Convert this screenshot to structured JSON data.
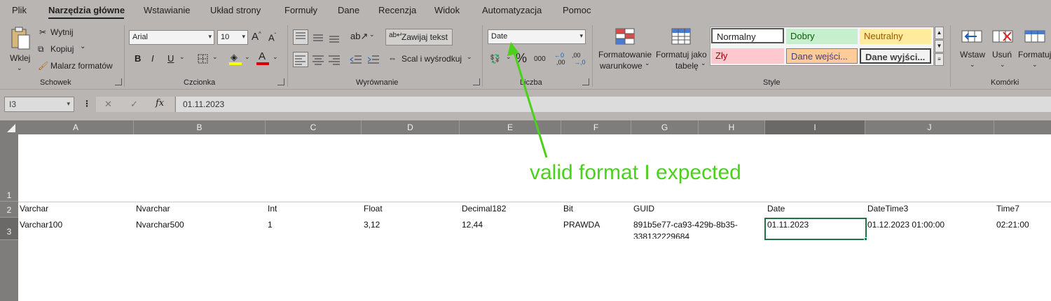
{
  "tabs": [
    "Plik",
    "Narzędzia główne",
    "Wstawianie",
    "Układ strony",
    "Formuły",
    "Dane",
    "Recenzja",
    "Widok",
    "Automatyzacja",
    "Pomoc"
  ],
  "active_tab": "Narzędzia główne",
  "clipboard": {
    "paste": "Wklej",
    "cut": "Wytnij",
    "copy": "Kopiuj",
    "format_painter": "Malarz formatów",
    "group": "Schowek"
  },
  "font": {
    "name": "Arial",
    "size": "10",
    "bold": "B",
    "italic": "I",
    "underline": "U",
    "grow": "A",
    "font_color": "A",
    "group": "Czcionka",
    "fill_color_hex": "#ffff00",
    "text_color_hex": "#e00000"
  },
  "alignment": {
    "wrap_text": "Zawijaj tekst",
    "merge_center": "Scal i wyśrodkuj",
    "group": "Wyrównanie"
  },
  "number": {
    "format": "Date",
    "percent": "%",
    "thousands": "000",
    "inc_decimal": ",00",
    "dec_decimal": ",0",
    "group": "Liczba"
  },
  "styles": {
    "conditional": "Formatowanie warunkowe",
    "conditional_line1": "Formatowanie",
    "conditional_line2": "warunkowe",
    "table_line1": "Formatuj jako",
    "table_line2": "tabelę",
    "items": {
      "normal": "Normalny",
      "good": "Dobry",
      "neutral": "Neutralny",
      "bad": "Zły",
      "input": "Dane wejści...",
      "output": "Dane wyjści..."
    },
    "group": "Style"
  },
  "cells": {
    "insert": "Wstaw",
    "delete": "Usuń",
    "format": "Formatuj",
    "group": "Komórki"
  },
  "formula_bar": {
    "name_box": "I3",
    "cancel": "✕",
    "enter": "✓",
    "fx": "fx",
    "value": "01.11.2023"
  },
  "columns": [
    "A",
    "B",
    "C",
    "D",
    "E",
    "F",
    "G",
    "H",
    "I",
    "J"
  ],
  "rows": [
    "1",
    "2",
    "3"
  ],
  "sheet_rows": {
    "r2": [
      "Varchar",
      "Nvarchar",
      "Int",
      "Float",
      "Decimal182",
      "Bit",
      "GUID",
      "Date",
      "DateTime3",
      "Time7"
    ],
    "r3": [
      "Varchar100",
      "Nvarchar500",
      "1",
      "3,12",
      "12,44",
      "PRAWDA",
      "891b5e77-ca93-429b-8b35-",
      "01.11.2023",
      "01.12.2023 01:00:00",
      "02:21:00"
    ],
    "r3_overflow": "338132229684"
  },
  "annotation": {
    "text": "valid format I expected",
    "color": "#4cd11b"
  }
}
